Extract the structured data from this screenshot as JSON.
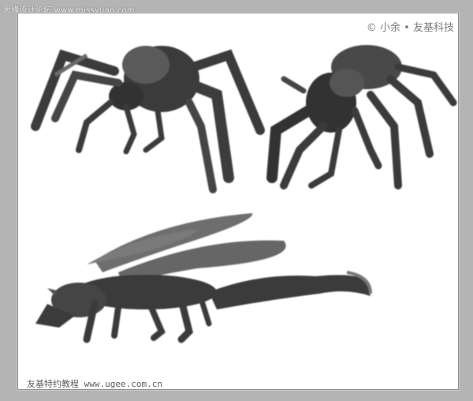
{
  "watermarks": {
    "top_left": "思缘设计论坛 www.missyuan.com",
    "top_right": "© 小余 • 友基科技",
    "bottom_left": "友基特约教程 www.ugee.com.cn"
  },
  "colors": {
    "background": "#b4b4b4",
    "canvas": "#ffffff",
    "ink_dark": "#3a3a3a",
    "ink_mid": "#5e5e5e",
    "ink_light": "#8a8a8a"
  }
}
